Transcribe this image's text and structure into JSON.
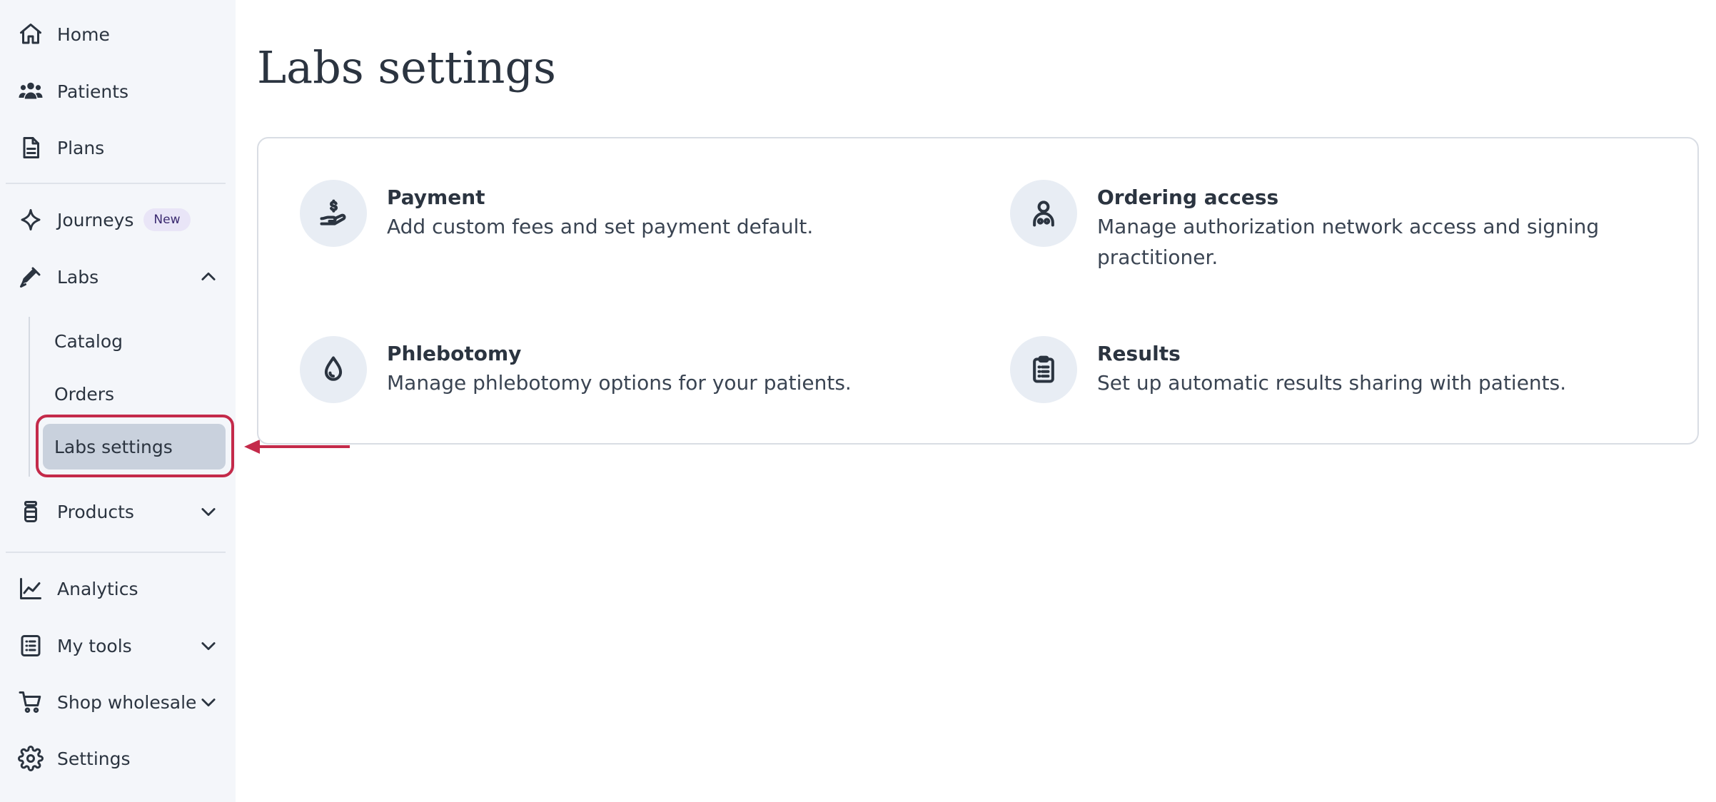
{
  "sidebar": {
    "items": [
      {
        "label": "Home",
        "icon": "home-icon"
      },
      {
        "label": "Patients",
        "icon": "users-icon"
      },
      {
        "label": "Plans",
        "icon": "document-icon"
      },
      {
        "label": "Journeys",
        "icon": "sparkle-icon",
        "badge": "New"
      },
      {
        "label": "Labs",
        "icon": "pipette-icon",
        "expanded": true
      },
      {
        "label": "Products",
        "icon": "bottle-icon",
        "expanded": false
      },
      {
        "label": "Analytics",
        "icon": "line-chart-icon"
      },
      {
        "label": "My tools",
        "icon": "checklist-icon",
        "expanded": false
      },
      {
        "label": "Shop wholesale",
        "icon": "cart-icon",
        "expanded": false
      },
      {
        "label": "Settings",
        "icon": "gear-icon"
      }
    ],
    "labs_subitems": [
      {
        "label": "Catalog"
      },
      {
        "label": "Orders"
      },
      {
        "label": "Labs settings",
        "active": true
      }
    ]
  },
  "main": {
    "title": "Labs settings",
    "settings": [
      {
        "title": "Payment",
        "description": "Add custom fees and set payment default.",
        "icon": "hand-dollar-icon"
      },
      {
        "title": "Ordering access",
        "description": "Manage authorization network access and signing practitioner.",
        "icon": "practitioner-icon"
      },
      {
        "title": "Phlebotomy",
        "description": "Manage phlebotomy options for your patients.",
        "icon": "droplet-icon"
      },
      {
        "title": "Results",
        "description": "Set up automatic results sharing with patients.",
        "icon": "clipboard-icon"
      }
    ]
  },
  "colors": {
    "sidebar_bg": "#f4f6fa",
    "active_bg": "#c9d1dd",
    "highlight": "#c42a4a",
    "text": "#2b3440",
    "icon_circle": "#e8edf4"
  }
}
